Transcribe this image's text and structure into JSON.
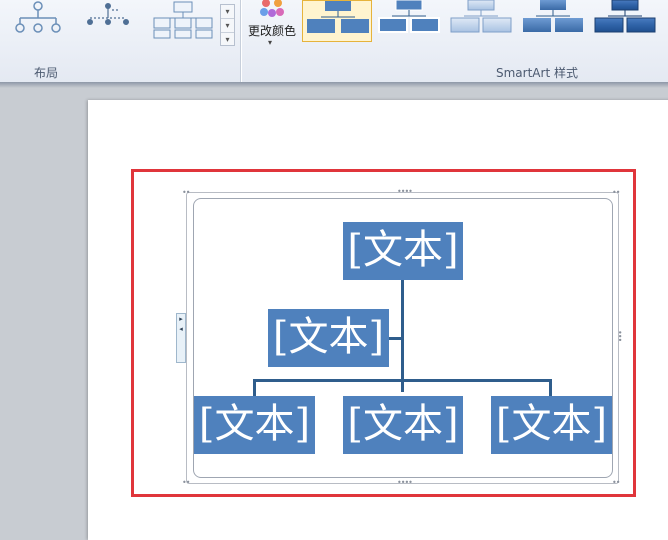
{
  "ribbon": {
    "layout_group_label": "布局",
    "change_colors_label": "更改颜色",
    "styles_group_label": "SmartArt 样式",
    "layouts": [
      {
        "icon": "hierarchy-layout-icon"
      },
      {
        "icon": "horizontal-hierarchy-layout-icon"
      },
      {
        "icon": "labeled-hierarchy-layout-icon"
      }
    ],
    "styles": [
      {
        "icon": "style-simple-fill-icon",
        "selected": true
      },
      {
        "icon": "style-white-outline-icon",
        "selected": false
      },
      {
        "icon": "style-subtle-effect-icon",
        "selected": false
      },
      {
        "icon": "style-moderate-effect-icon",
        "selected": false
      },
      {
        "icon": "style-intense-effect-icon",
        "selected": false
      }
    ]
  },
  "smartart": {
    "node_fill": "#4f81bd",
    "connector_color": "#2f5d8c",
    "nodes": [
      {
        "label": "[文本]",
        "role": "top"
      },
      {
        "label": "[文本]",
        "role": "assistant"
      },
      {
        "label": "[文本]",
        "role": "child-1"
      },
      {
        "label": "[文本]",
        "role": "child-2"
      },
      {
        "label": "[文本]",
        "role": "child-3"
      }
    ]
  },
  "highlight_color": "#e0353b"
}
